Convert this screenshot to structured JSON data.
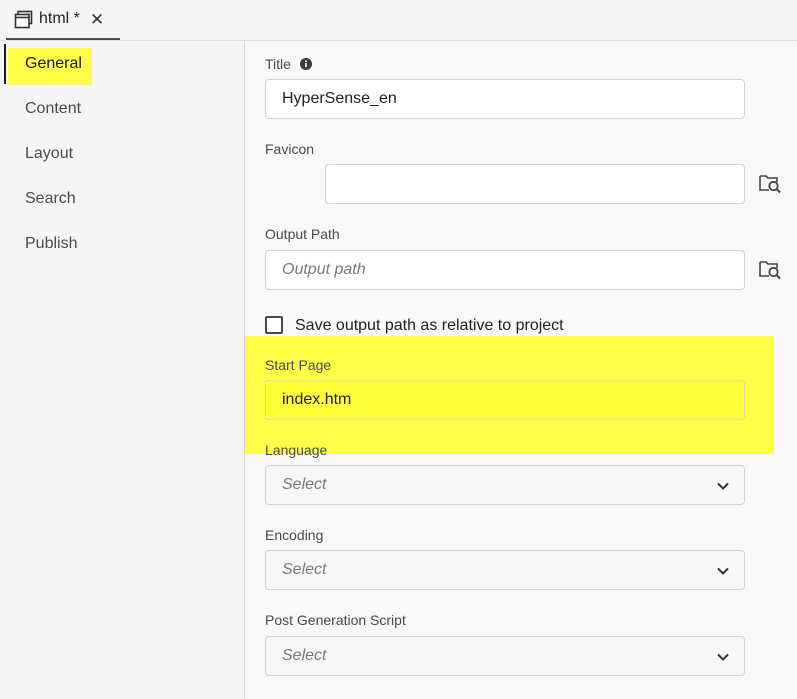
{
  "tab": {
    "label": "html *",
    "close": "✕"
  },
  "sidebar": {
    "items": [
      {
        "label": "General"
      },
      {
        "label": "Content"
      },
      {
        "label": "Layout"
      },
      {
        "label": "Search"
      },
      {
        "label": "Publish"
      }
    ],
    "active": "General"
  },
  "form": {
    "title": {
      "label": "Title",
      "value": "HyperSense_en"
    },
    "favicon": {
      "label": "Favicon",
      "value": ""
    },
    "output_path": {
      "label": "Output Path",
      "placeholder": "Output path"
    },
    "relative_checkbox": {
      "label": "Save output path as relative to project",
      "checked": false
    },
    "start_page": {
      "label": "Start Page",
      "value": "index.htm"
    },
    "language": {
      "label": "Language",
      "value": "Select"
    },
    "encoding": {
      "label": "Encoding",
      "value": "Select"
    },
    "post_script": {
      "label": "Post Generation Script",
      "value": "Select"
    }
  },
  "colors": {
    "highlight": "#ffff4a",
    "text": "#2c2c2c",
    "border": "#d3d3d3"
  },
  "icons": {
    "tab": "window-icon",
    "info": "info-icon",
    "browse": "folder-search-icon",
    "dropdown": "chevron-down-icon"
  }
}
